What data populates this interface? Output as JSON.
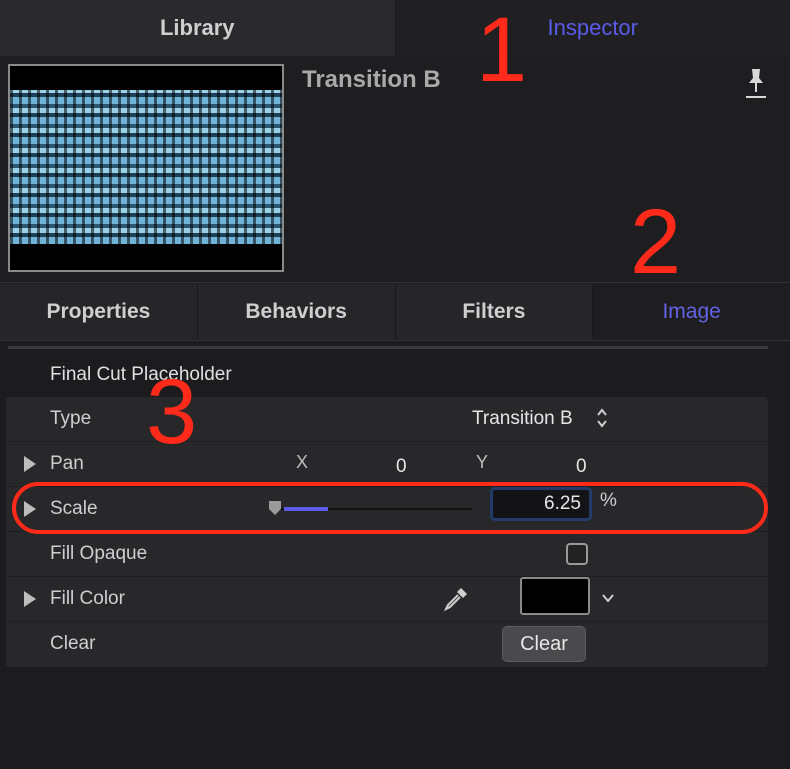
{
  "tabs": {
    "library": "Library",
    "inspector": "Inspector"
  },
  "header": {
    "clip_title": "Transition B"
  },
  "sub_tabs": [
    "Properties",
    "Behaviors",
    "Filters",
    "Image"
  ],
  "section": {
    "title": "Final Cut Placeholder"
  },
  "params": {
    "type": {
      "label": "Type",
      "value": "Transition B"
    },
    "pan": {
      "label": "Pan",
      "x_label": "X",
      "x_value": "0",
      "y_label": "Y",
      "y_value": "0"
    },
    "scale": {
      "label": "Scale",
      "value": "6.25",
      "unit": "%",
      "slider_fraction": 0.06
    },
    "fill_opaque": {
      "label": "Fill Opaque",
      "checked": false
    },
    "fill_color": {
      "label": "Fill Color",
      "color": "#000000"
    },
    "clear": {
      "label": "Clear",
      "button": "Clear"
    }
  },
  "annotations": {
    "one": "1",
    "two": "2",
    "three": "3"
  },
  "colors": {
    "accent": "#5b5be8",
    "annotation": "#ff2a1a"
  }
}
